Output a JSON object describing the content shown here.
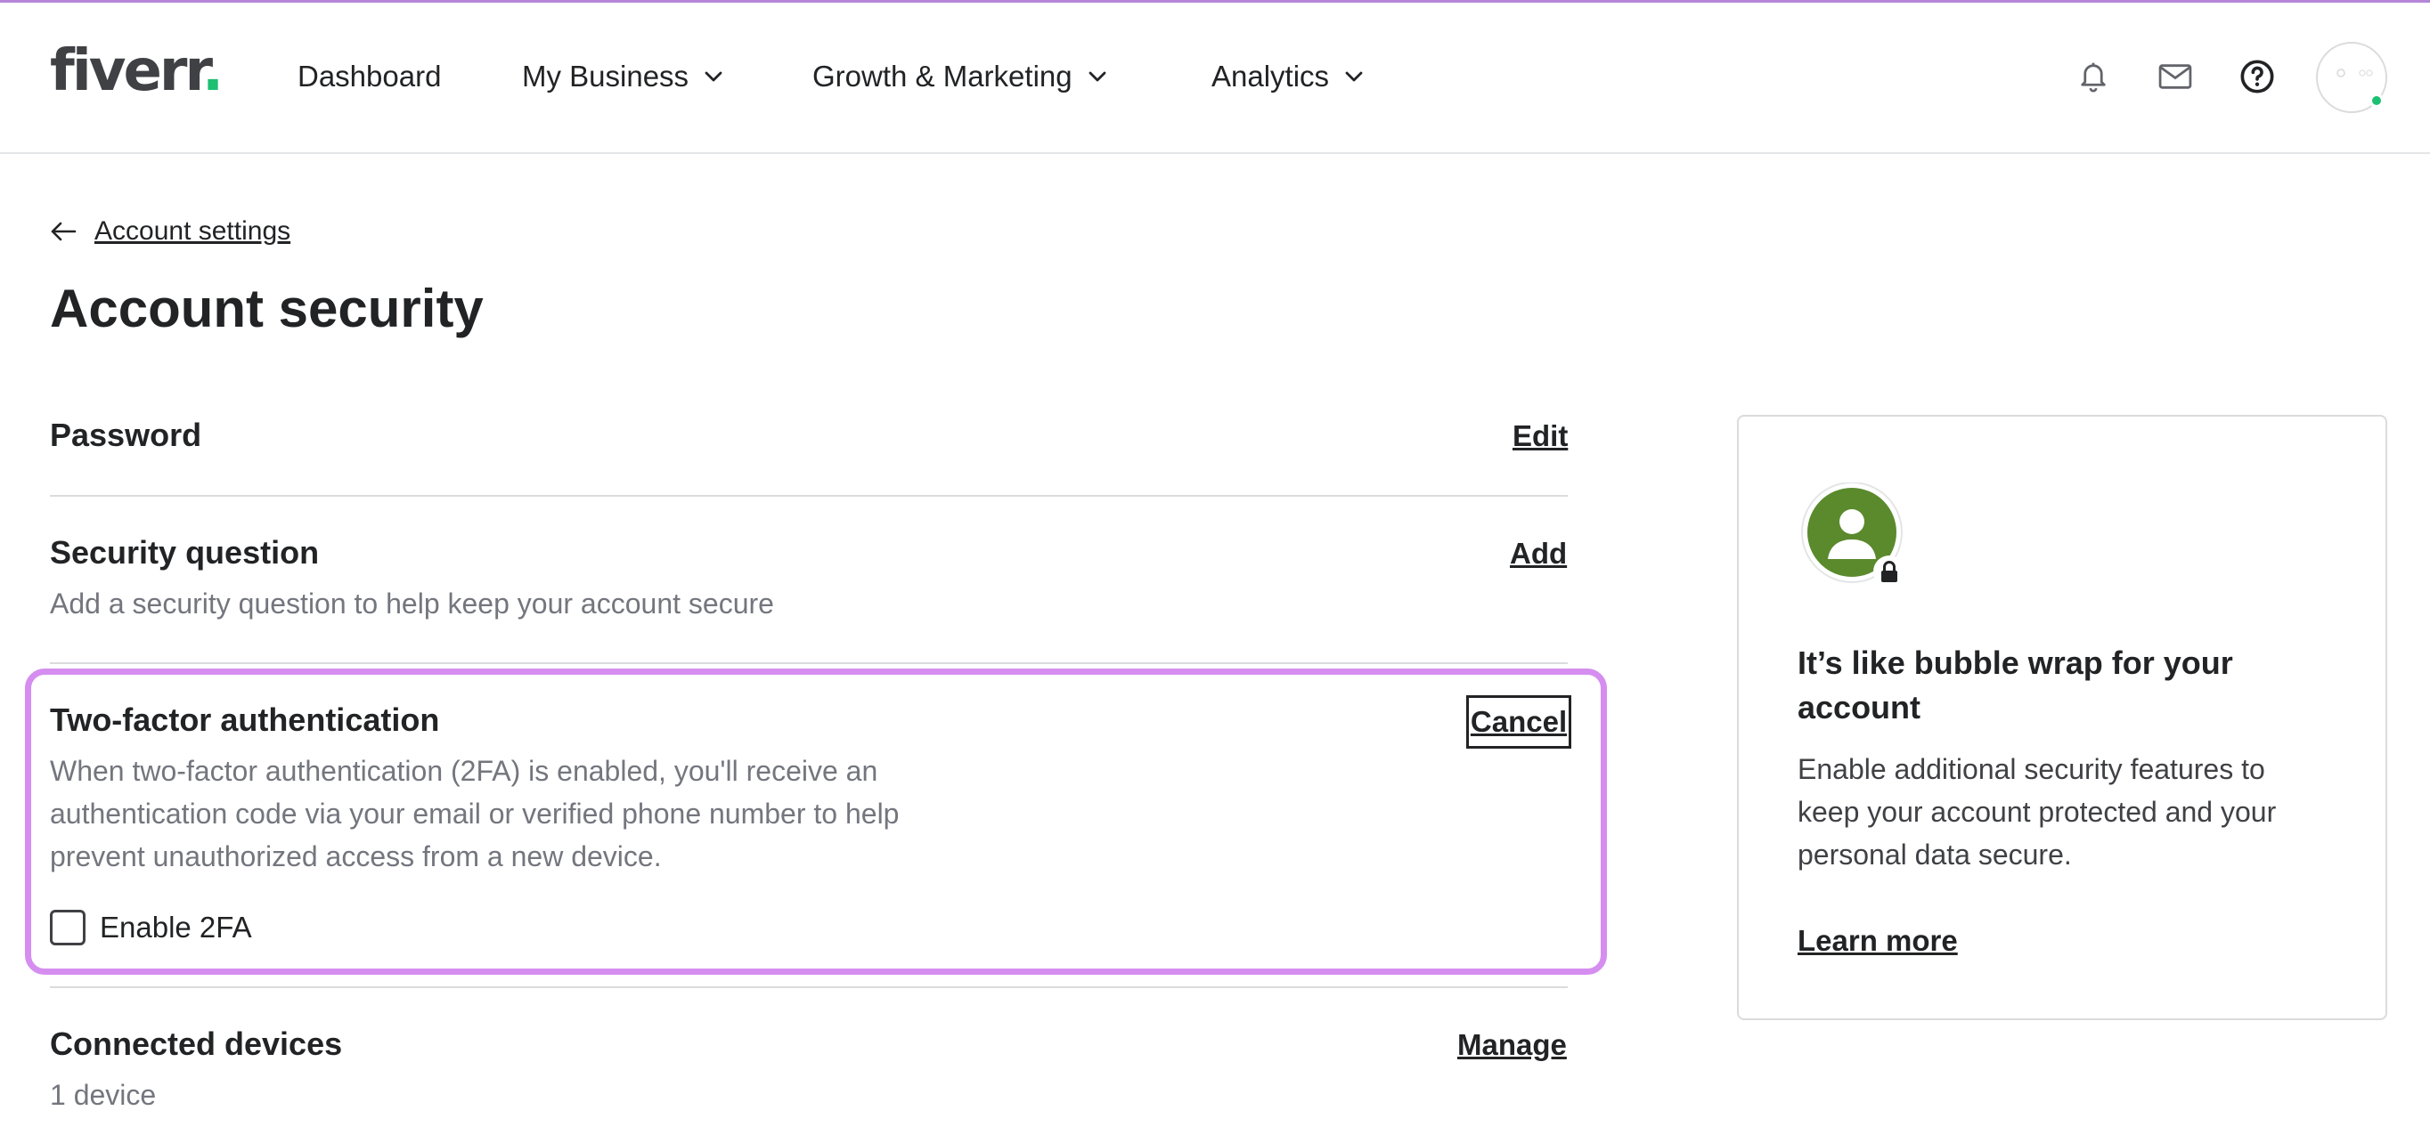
{
  "header": {
    "logo_text": "fiverr",
    "logo_dot": ".",
    "nav": {
      "dashboard": "Dashboard",
      "my_business": "My Business",
      "growth_marketing": "Growth & Marketing",
      "analytics": "Analytics"
    },
    "icons": [
      "bell-icon",
      "envelope-icon",
      "help-icon"
    ],
    "status_color": "#1dbf73"
  },
  "breadcrumb": {
    "back_label": "Account settings"
  },
  "page": {
    "title": "Account security"
  },
  "sections": {
    "password": {
      "title": "Password",
      "action": "Edit"
    },
    "security_question": {
      "title": "Security question",
      "description": "Add a security question to help keep your account secure",
      "action": "Add"
    },
    "two_factor": {
      "title": "Two-factor authentication",
      "description_line1": "When two-factor authentication (2FA) is enabled, you'll receive an",
      "description_line2": "authentication code via your email or verified phone number to help",
      "description_line3": "prevent unauthorized access from a new device.",
      "action": "Cancel",
      "checkbox_label": "Enable 2FA",
      "checkbox_checked": false,
      "highlight_color": "#d58ef0"
    },
    "connected_devices": {
      "title": "Connected devices",
      "description": "1 device",
      "action": "Manage"
    }
  },
  "side_card": {
    "title_line1": "It’s like bubble wrap for your",
    "title_line2": "account",
    "body_line1": "Enable additional security features to",
    "body_line2": "keep your account protected and your",
    "body_line3": "personal data secure.",
    "link": "Learn more",
    "illustration_color": "#5a8a2c"
  }
}
